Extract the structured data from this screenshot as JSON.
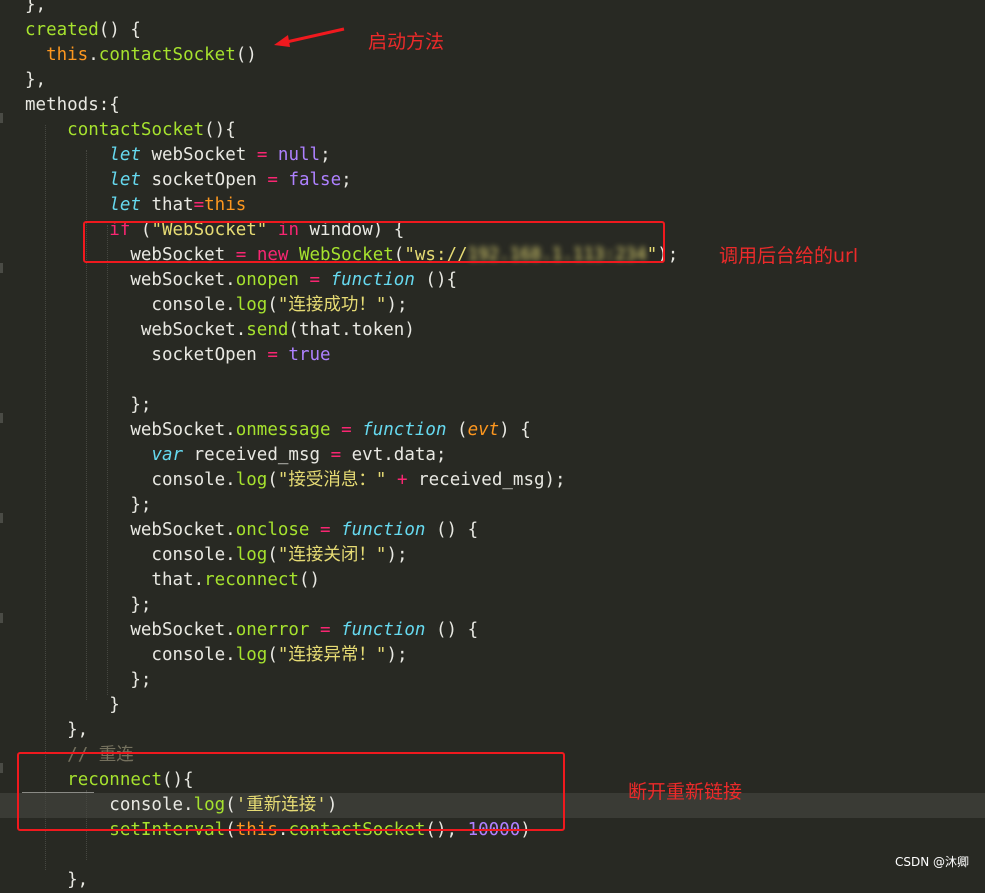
{
  "code_lines": [
    [
      [
        "pl",
        "},"
      ]
    ],
    [
      [
        "fn",
        "created"
      ],
      [
        "pl",
        "() {"
      ]
    ],
    [
      [
        "pl",
        "  "
      ],
      [
        "su",
        "this"
      ],
      [
        "pl",
        "."
      ],
      [
        "fn",
        "contactSocket"
      ],
      [
        "pl",
        "()"
      ]
    ],
    [
      [
        "pl",
        "},"
      ]
    ],
    [
      [
        "pl",
        "methods:{"
      ]
    ],
    [
      [
        "pl",
        "    "
      ],
      [
        "fn",
        "contactSocket"
      ],
      [
        "pl",
        "(){"
      ]
    ],
    [
      [
        "pl",
        "        "
      ],
      [
        "it",
        "let"
      ],
      [
        "pl",
        " webSocket "
      ],
      [
        "kw",
        "="
      ],
      [
        "pl",
        " "
      ],
      [
        "cn",
        "null"
      ],
      [
        "pl",
        ";"
      ]
    ],
    [
      [
        "pl",
        "        "
      ],
      [
        "it",
        "let"
      ],
      [
        "pl",
        " socketOpen "
      ],
      [
        "kw",
        "="
      ],
      [
        "pl",
        " "
      ],
      [
        "cn",
        "false"
      ],
      [
        "pl",
        ";"
      ]
    ],
    [
      [
        "pl",
        "        "
      ],
      [
        "it",
        "let"
      ],
      [
        "pl",
        " that"
      ],
      [
        "kw",
        "="
      ],
      [
        "su",
        "this"
      ]
    ],
    [
      [
        "pl",
        "        "
      ],
      [
        "kw",
        "if"
      ],
      [
        "pl",
        " ("
      ],
      [
        "st",
        "\"WebSocket\""
      ],
      [
        "pl",
        " "
      ],
      [
        "kw",
        "in"
      ],
      [
        "pl",
        " window) {"
      ]
    ],
    [
      [
        "pl",
        "          webSocket "
      ],
      [
        "kw",
        "="
      ],
      [
        "pl",
        " "
      ],
      [
        "kw",
        "new"
      ],
      [
        "pl",
        " "
      ],
      [
        "fn",
        "WebSocket"
      ],
      [
        "pl",
        "("
      ],
      [
        "st",
        "\"ws://"
      ],
      [
        "blur",
        "192.168.1.113:234"
      ],
      [
        "st",
        "\""
      ],
      [
        "pl",
        ");"
      ]
    ],
    [
      [
        "pl",
        "          webSocket."
      ],
      [
        "fn",
        "onopen"
      ],
      [
        "pl",
        " "
      ],
      [
        "kw",
        "="
      ],
      [
        "pl",
        " "
      ],
      [
        "it",
        "function"
      ],
      [
        "pl",
        " (){"
      ]
    ],
    [
      [
        "pl",
        "            console."
      ],
      [
        "fn",
        "log"
      ],
      [
        "pl",
        "("
      ],
      [
        "st",
        "\"连接成功！\""
      ],
      [
        "pl",
        ");"
      ]
    ],
    [
      [
        "pl",
        "           webSocket."
      ],
      [
        "fn",
        "send"
      ],
      [
        "pl",
        "(that.token)"
      ]
    ],
    [
      [
        "pl",
        "            socketOpen "
      ],
      [
        "kw",
        "="
      ],
      [
        "pl",
        " "
      ],
      [
        "cn",
        "true"
      ]
    ],
    [
      [
        "pl",
        ""
      ]
    ],
    [
      [
        "pl",
        "          };"
      ]
    ],
    [
      [
        "pl",
        "          webSocket."
      ],
      [
        "fn",
        "onmessage"
      ],
      [
        "pl",
        " "
      ],
      [
        "kw",
        "="
      ],
      [
        "pl",
        " "
      ],
      [
        "it",
        "function"
      ],
      [
        "pl",
        " ("
      ],
      [
        "pa",
        "evt"
      ],
      [
        "pl",
        ") {"
      ]
    ],
    [
      [
        "pl",
        "            "
      ],
      [
        "it",
        "var"
      ],
      [
        "pl",
        " received_msg "
      ],
      [
        "kw",
        "="
      ],
      [
        "pl",
        " evt.data;"
      ]
    ],
    [
      [
        "pl",
        "            console."
      ],
      [
        "fn",
        "log"
      ],
      [
        "pl",
        "("
      ],
      [
        "st",
        "\"接受消息：\""
      ],
      [
        "pl",
        " "
      ],
      [
        "kw",
        "+"
      ],
      [
        "pl",
        " received_msg);"
      ]
    ],
    [
      [
        "pl",
        "          };"
      ]
    ],
    [
      [
        "pl",
        "          webSocket."
      ],
      [
        "fn",
        "onclose"
      ],
      [
        "pl",
        " "
      ],
      [
        "kw",
        "="
      ],
      [
        "pl",
        " "
      ],
      [
        "it",
        "function"
      ],
      [
        "pl",
        " () {"
      ]
    ],
    [
      [
        "pl",
        "            console."
      ],
      [
        "fn",
        "log"
      ],
      [
        "pl",
        "("
      ],
      [
        "st",
        "\"连接关闭！\""
      ],
      [
        "pl",
        ");"
      ]
    ],
    [
      [
        "pl",
        "            that."
      ],
      [
        "fn",
        "reconnect"
      ],
      [
        "pl",
        "()"
      ]
    ],
    [
      [
        "pl",
        "          };"
      ]
    ],
    [
      [
        "pl",
        "          webSocket."
      ],
      [
        "fn",
        "onerror"
      ],
      [
        "pl",
        " "
      ],
      [
        "kw",
        "="
      ],
      [
        "pl",
        " "
      ],
      [
        "it",
        "function"
      ],
      [
        "pl",
        " () {"
      ]
    ],
    [
      [
        "pl",
        "            console."
      ],
      [
        "fn",
        "log"
      ],
      [
        "pl",
        "("
      ],
      [
        "st",
        "\"连接异常！\""
      ],
      [
        "pl",
        ");"
      ]
    ],
    [
      [
        "pl",
        "          };"
      ]
    ],
    [
      [
        "pl",
        "        }"
      ]
    ],
    [
      [
        "pl",
        "    },"
      ]
    ],
    [
      [
        "pl",
        "    "
      ],
      [
        "cm",
        "// 重连"
      ]
    ],
    [
      [
        "pl",
        "    "
      ],
      [
        "fn",
        "reconnect"
      ],
      [
        "pl",
        "(){"
      ]
    ],
    [
      [
        "pl",
        "        console."
      ],
      [
        "fn",
        "log"
      ],
      [
        "pl",
        "("
      ],
      [
        "st",
        "'重新连接'"
      ],
      [
        "pl",
        ")"
      ]
    ],
    [
      [
        "pl",
        "        "
      ],
      [
        "fn",
        "setInterval"
      ],
      [
        "pl",
        "("
      ],
      [
        "su",
        "this"
      ],
      [
        "pl",
        "."
      ],
      [
        "fn",
        "contactSocket"
      ],
      [
        "pl",
        "(), "
      ],
      [
        "cn",
        "10000"
      ],
      [
        "pl",
        ")"
      ]
    ],
    [
      [
        "pl",
        ""
      ]
    ],
    [
      [
        "pl",
        "    },"
      ]
    ]
  ],
  "annotations": {
    "startup": "启动方法",
    "backend_url": "调用后台给的url",
    "reconnect": "断开重新链接"
  },
  "watermark": "CSDN @沐卿",
  "colors": {
    "background": "#282923",
    "annotation_red": "#f0191e",
    "keyword": "#f92672",
    "string": "#e6db74",
    "function": "#a6e22e",
    "this": "#fd971f",
    "storage": "#66d9ef",
    "constant": "#ae81ff",
    "comment": "#75715e"
  }
}
